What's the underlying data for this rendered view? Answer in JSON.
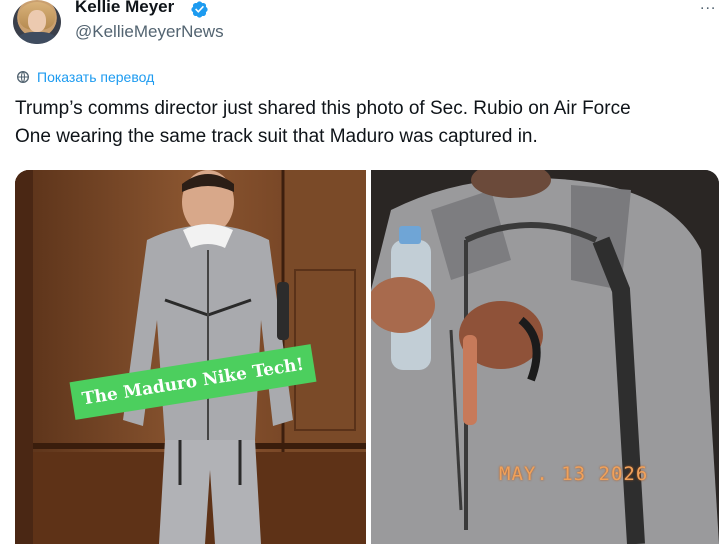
{
  "author": {
    "name": "Kellie Meyer",
    "handle": "@KellieMeyerNews",
    "verified_icon": "verified-badge-icon",
    "more_label": "..."
  },
  "translate": {
    "label": "Показать перевод",
    "icon": "globe-translate-icon"
  },
  "tweet": {
    "line1": "Trump’s comms director just shared this photo of Sec. Rubio on Air Force",
    "line2": "One wearing the same track suit that Maduro was captured in."
  },
  "media": {
    "left_overlay_text": "The Maduro Nike Tech!",
    "right_date_stamp": "MAY. 13 2026"
  },
  "colors": {
    "accent": "#1d9bf0",
    "text": "#0f1419",
    "secondary_text": "#536471",
    "badge_green": "#4ccf5e",
    "date_orange": "#f0a15a"
  }
}
